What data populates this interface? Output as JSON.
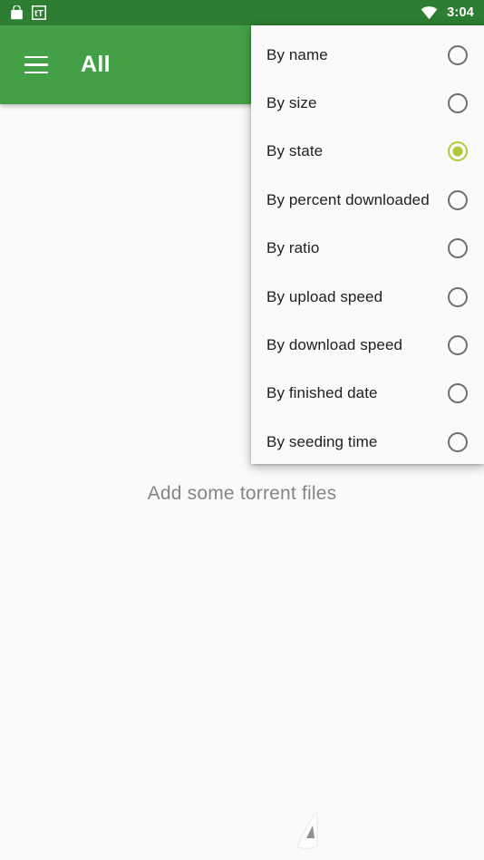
{
  "status_bar": {
    "icons": [
      "shopping-bag-icon",
      "tt-app-icon",
      "wifi-icon"
    ],
    "app_badge_text": "tT",
    "time": "3:04",
    "background_color": "#2d7d32",
    "text_color": "#ffffff"
  },
  "toolbar": {
    "menu_icon": "hamburger-menu-icon",
    "title": "All",
    "background_color": "#43a047",
    "text_color": "#ffffff"
  },
  "content": {
    "empty_state_text": "Add some torrent files",
    "background_color": "#fafafa",
    "empty_text_color": "#858585"
  },
  "sort_menu": {
    "background_color": "#fafafa",
    "selected_color": "#b0ca3a",
    "unselected_color": "#6e6e6e",
    "items": [
      {
        "label": "By name",
        "selected": false
      },
      {
        "label": "By size",
        "selected": false
      },
      {
        "label": "By state",
        "selected": true
      },
      {
        "label": "By percent downloaded",
        "selected": false
      },
      {
        "label": "By ratio",
        "selected": false
      },
      {
        "label": "By upload speed",
        "selected": false
      },
      {
        "label": "By download speed",
        "selected": false
      },
      {
        "label": "By finished date",
        "selected": false
      },
      {
        "label": "By seeding time",
        "selected": false
      }
    ]
  }
}
